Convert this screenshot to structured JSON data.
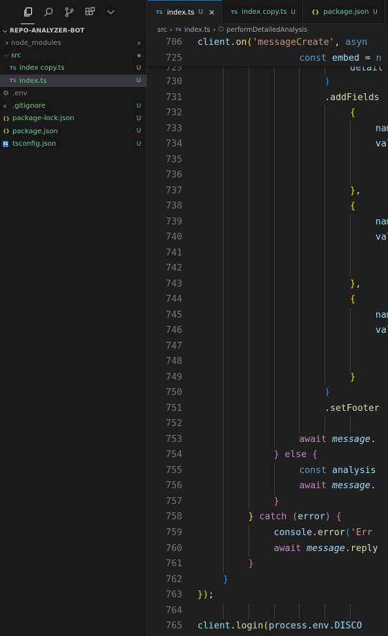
{
  "activity_bar": {
    "icons": [
      "explorer-icon",
      "search-icon",
      "source-control-icon",
      "extensions-icon",
      "chevron-down-icon"
    ]
  },
  "explorer": {
    "root_label": "REPO-ANALYZER-BOT",
    "items": [
      {
        "name": "node_modules",
        "type": "folder",
        "expanded": false,
        "indent": 1,
        "color": "#8b8b8b",
        "decoration": "dot",
        "deco_color": "#4a4a4a"
      },
      {
        "name": "src",
        "type": "folder",
        "expanded": true,
        "indent": 1,
        "color": "#73c991",
        "decoration": "dot",
        "deco_color": "#5a8a5a"
      },
      {
        "name": "index copy.ts",
        "type": "ts",
        "indent": 2,
        "color": "#73c991",
        "status": "U"
      },
      {
        "name": "index.ts",
        "type": "ts",
        "indent": 2,
        "color": "#73c991",
        "status": "U",
        "selected": true
      },
      {
        "name": ".env",
        "type": "gear",
        "indent": 1,
        "color": "#8b8b8b",
        "status": ""
      },
      {
        "name": ".gitignore",
        "type": "git",
        "indent": 1,
        "color": "#73c991",
        "status": "U"
      },
      {
        "name": "package-lock.json",
        "type": "json",
        "indent": 1,
        "color": "#73c991",
        "status": "U"
      },
      {
        "name": "package.json",
        "type": "json",
        "indent": 1,
        "color": "#73c991",
        "status": "U"
      },
      {
        "name": "tsconfig.json",
        "type": "tsconfig",
        "indent": 1,
        "color": "#73c991",
        "status": "U"
      }
    ]
  },
  "tabs": [
    {
      "label": "index.ts",
      "icon": "TS",
      "status": "U",
      "active": true,
      "close": "✕"
    },
    {
      "label": "index copy.ts",
      "icon": "TS",
      "status": "U",
      "active": false
    },
    {
      "label": "package.json",
      "icon": "{}",
      "status": "U",
      "active": false
    }
  ],
  "breadcrumb": {
    "folder": "src",
    "file": "index.ts",
    "symbol": "performDetailedAnalysis"
  },
  "sticky_lines": [
    {
      "num": "706",
      "indent": 0,
      "tokens": [
        [
          "client",
          "var"
        ],
        [
          ".",
          "punct"
        ],
        [
          "on",
          "fn"
        ],
        [
          "(",
          "p1"
        ],
        [
          "'messageCreate'",
          "str"
        ],
        [
          ", ",
          "punct"
        ],
        [
          "asyn",
          "kw"
        ]
      ]
    },
    {
      "num": "725",
      "indent": 4,
      "tokens": [
        [
          "const ",
          "kw"
        ],
        [
          "embed",
          "var"
        ],
        [
          " = ",
          "punct"
        ],
        [
          "n",
          "kw"
        ]
      ]
    }
  ],
  "code_lines": [
    {
      "num": "729",
      "indent": 6,
      "tokens": [
        [
          "detail",
          "var"
        ]
      ],
      "partial": true
    },
    {
      "num": "730",
      "indent": 5,
      "tokens": [
        [
          ")",
          "p3"
        ]
      ]
    },
    {
      "num": "731",
      "indent": 5,
      "tokens": [
        [
          ".",
          "punct"
        ],
        [
          "addFields",
          "fn"
        ]
      ]
    },
    {
      "num": "732",
      "indent": 6,
      "tokens": [
        [
          "{",
          "p1"
        ]
      ]
    },
    {
      "num": "733",
      "indent": 7,
      "tokens": [
        [
          "nam",
          "var"
        ]
      ]
    },
    {
      "num": "734",
      "indent": 7,
      "tokens": [
        [
          "val",
          "var"
        ]
      ]
    },
    {
      "num": "735",
      "indent": 0,
      "tokens": []
    },
    {
      "num": "736",
      "indent": 0,
      "tokens": []
    },
    {
      "num": "737",
      "indent": 6,
      "tokens": [
        [
          "}",
          "p1"
        ],
        [
          ",",
          "punct"
        ]
      ]
    },
    {
      "num": "738",
      "indent": 6,
      "tokens": [
        [
          "{",
          "p1"
        ]
      ]
    },
    {
      "num": "739",
      "indent": 7,
      "tokens": [
        [
          "nam",
          "var"
        ]
      ]
    },
    {
      "num": "740",
      "indent": 7,
      "tokens": [
        [
          "val",
          "var"
        ]
      ]
    },
    {
      "num": "741",
      "indent": 0,
      "tokens": []
    },
    {
      "num": "742",
      "indent": 0,
      "tokens": []
    },
    {
      "num": "743",
      "indent": 6,
      "tokens": [
        [
          "}",
          "p1"
        ],
        [
          ",",
          "punct"
        ]
      ]
    },
    {
      "num": "744",
      "indent": 6,
      "tokens": [
        [
          "{",
          "p1"
        ]
      ]
    },
    {
      "num": "745",
      "indent": 7,
      "tokens": [
        [
          "nam",
          "var"
        ]
      ]
    },
    {
      "num": "746",
      "indent": 7,
      "tokens": [
        [
          "val",
          "var"
        ]
      ]
    },
    {
      "num": "747",
      "indent": 0,
      "tokens": []
    },
    {
      "num": "748",
      "indent": 0,
      "tokens": []
    },
    {
      "num": "749",
      "indent": 6,
      "tokens": [
        [
          "}",
          "p1"
        ]
      ]
    },
    {
      "num": "750",
      "indent": 5,
      "tokens": [
        [
          ")",
          "p3"
        ]
      ]
    },
    {
      "num": "751",
      "indent": 5,
      "tokens": [
        [
          ".",
          "punct"
        ],
        [
          "setFooter",
          "fn"
        ]
      ]
    },
    {
      "num": "752",
      "indent": 0,
      "tokens": []
    },
    {
      "num": "753",
      "indent": 4,
      "tokens": [
        [
          "await ",
          "ctl"
        ],
        [
          "message",
          "it"
        ],
        [
          ".",
          "punct"
        ]
      ]
    },
    {
      "num": "754",
      "indent": 3,
      "tokens": [
        [
          "}",
          "p2"
        ],
        [
          " ",
          "punct"
        ],
        [
          "else",
          "ctl"
        ],
        [
          " ",
          "punct"
        ],
        [
          "{",
          "p2"
        ]
      ]
    },
    {
      "num": "755",
      "indent": 4,
      "tokens": [
        [
          "const ",
          "kw"
        ],
        [
          "analysis",
          "var"
        ]
      ]
    },
    {
      "num": "756",
      "indent": 4,
      "tokens": [
        [
          "await ",
          "ctl"
        ],
        [
          "message",
          "it"
        ],
        [
          ".",
          "punct"
        ]
      ]
    },
    {
      "num": "757",
      "indent": 3,
      "tokens": [
        [
          "}",
          "p2"
        ]
      ]
    },
    {
      "num": "758",
      "indent": 2,
      "tokens": [
        [
          "}",
          "p1"
        ],
        [
          " ",
          "punct"
        ],
        [
          "catch",
          "ctl"
        ],
        [
          " ",
          "punct"
        ],
        [
          "(",
          "p2"
        ],
        [
          "error",
          "var"
        ],
        [
          ")",
          "p2"
        ],
        [
          " ",
          "punct"
        ],
        [
          "{",
          "p2"
        ]
      ]
    },
    {
      "num": "759",
      "indent": 3,
      "tokens": [
        [
          "console",
          "var"
        ],
        [
          ".",
          "punct"
        ],
        [
          "error",
          "fn"
        ],
        [
          "(",
          "p3"
        ],
        [
          "'Err",
          "str"
        ]
      ]
    },
    {
      "num": "760",
      "indent": 3,
      "tokens": [
        [
          "await ",
          "ctl"
        ],
        [
          "message",
          "it"
        ],
        [
          ".",
          "punct"
        ],
        [
          "reply",
          "fn"
        ]
      ]
    },
    {
      "num": "761",
      "indent": 2,
      "tokens": [
        [
          "}",
          "p2"
        ]
      ]
    },
    {
      "num": "762",
      "indent": 1,
      "tokens": [
        [
          "}",
          "p3"
        ]
      ]
    },
    {
      "num": "763",
      "indent": 0,
      "tokens": [
        [
          "}",
          "p1"
        ],
        [
          ")",
          "p1"
        ],
        [
          ";",
          "punct"
        ]
      ]
    },
    {
      "num": "764",
      "indent": 0,
      "tokens": []
    },
    {
      "num": "765",
      "indent": 0,
      "tokens": [
        [
          "client",
          "var"
        ],
        [
          ".",
          "punct"
        ],
        [
          "login",
          "fn"
        ],
        [
          "(",
          "p1"
        ],
        [
          "process",
          "var"
        ],
        [
          ".",
          "punct"
        ],
        [
          "env",
          "var"
        ],
        [
          ".",
          "punct"
        ],
        [
          "DISCO",
          "var"
        ]
      ]
    }
  ],
  "colors": {
    "accent": "#0078d4",
    "untracked": "#73c991",
    "ts_icon": "#519aba",
    "json_icon": "#cbcb41"
  }
}
